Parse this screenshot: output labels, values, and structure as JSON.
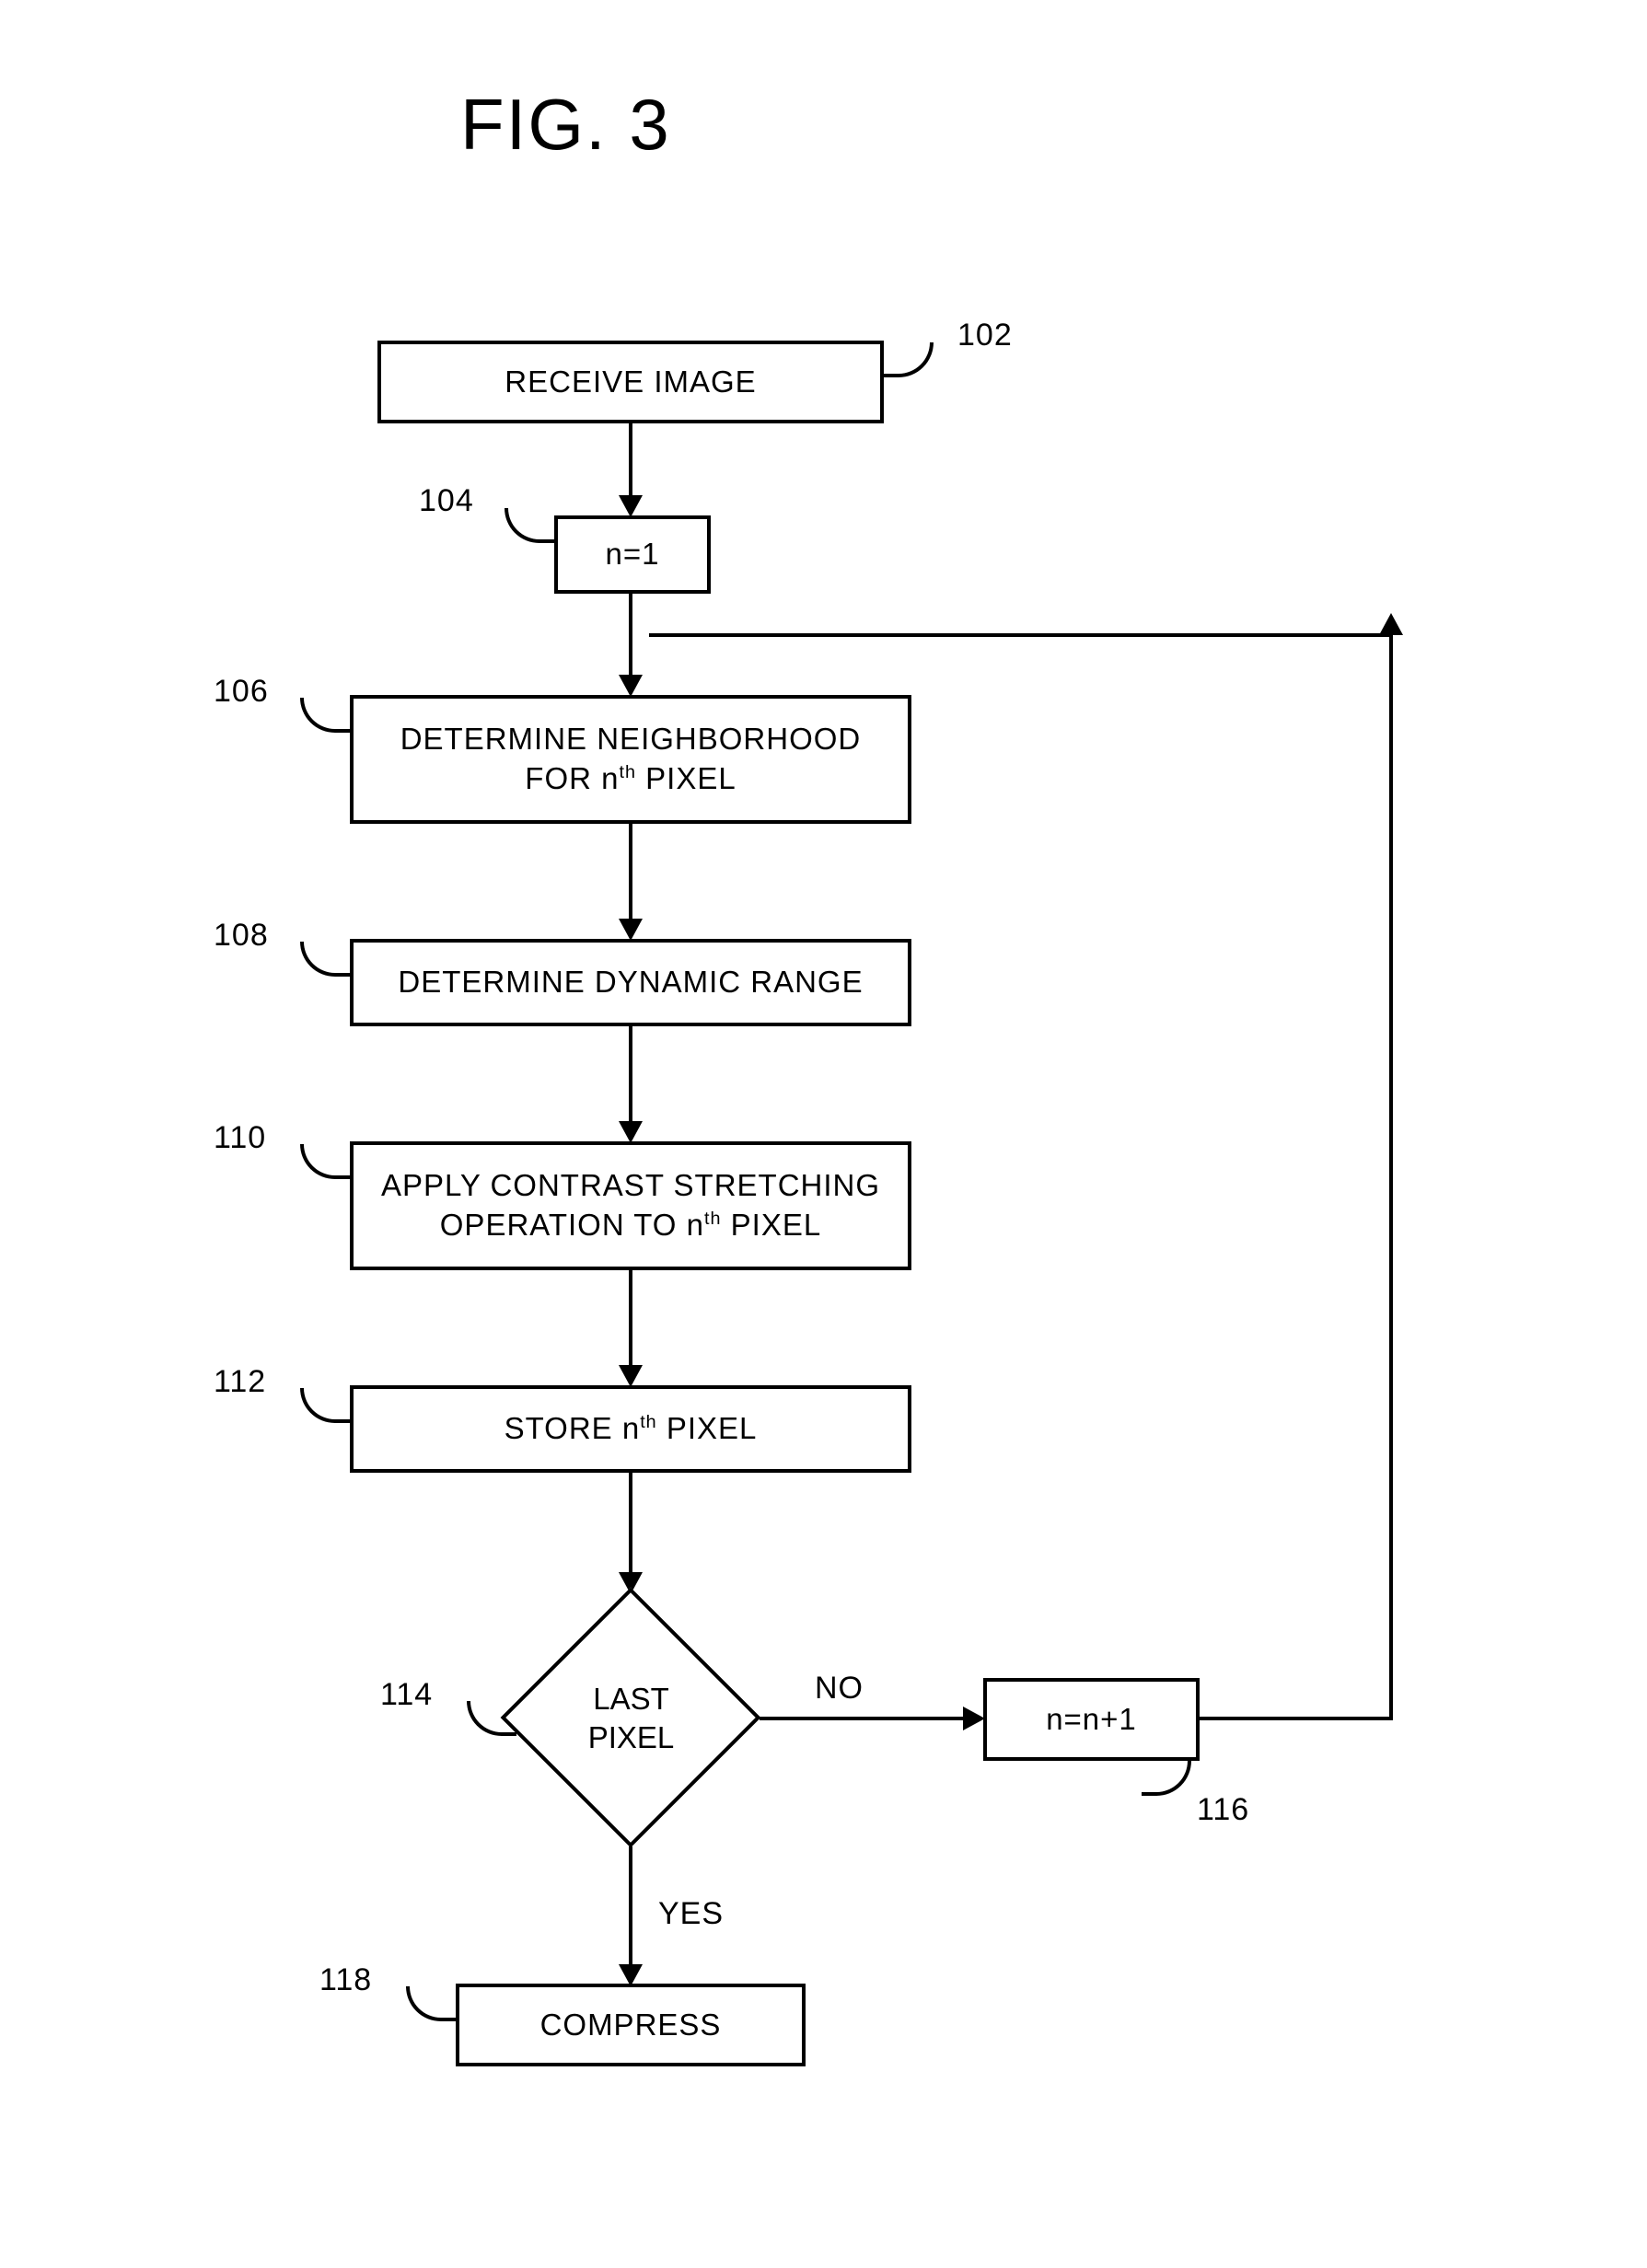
{
  "title": "FIG. 3",
  "steps": {
    "s102": {
      "ref": "102",
      "text": "RECEIVE IMAGE"
    },
    "s104": {
      "ref": "104",
      "text": "n=1"
    },
    "s106": {
      "ref": "106",
      "line1": "DETERMINE NEIGHBORHOOD",
      "line2_a": "FOR n",
      "line2_sup": "th",
      "line2_b": " PIXEL"
    },
    "s108": {
      "ref": "108",
      "text": "DETERMINE DYNAMIC RANGE"
    },
    "s110": {
      "ref": "110",
      "line1": "APPLY CONTRAST STRETCHING",
      "line2_a": "OPERATION TO n",
      "line2_sup": "th",
      "line2_b": " PIXEL"
    },
    "s112": {
      "ref": "112",
      "line1_a": "STORE n",
      "line1_sup": "th",
      "line1_b": " PIXEL"
    },
    "s114": {
      "ref": "114",
      "line1": "LAST",
      "line2": "PIXEL"
    },
    "s116": {
      "ref": "116",
      "text": "n=n+1"
    },
    "s118": {
      "ref": "118",
      "text": "COMPRESS"
    }
  },
  "labels": {
    "no": "NO",
    "yes": "YES"
  }
}
